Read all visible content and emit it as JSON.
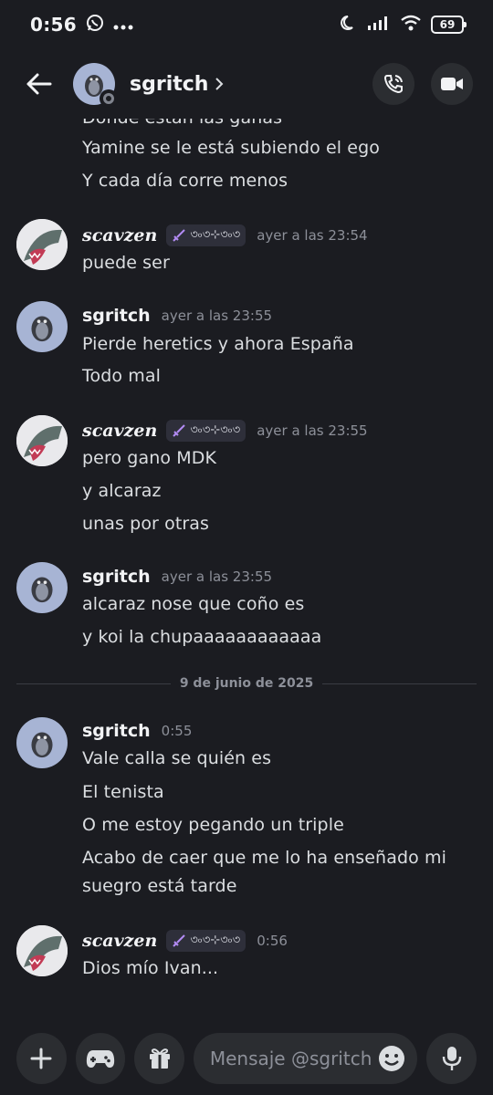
{
  "status_bar": {
    "time": "0:56",
    "battery": "69",
    "icons": [
      "whatsapp-icon",
      "more-icon",
      "moon-icon",
      "signal-icon",
      "wifi-icon",
      "battery-icon"
    ]
  },
  "header": {
    "name": "sgritch",
    "icons": [
      "back-arrow-icon",
      "chevron-right-icon",
      "voice-call-icon",
      "video-call-icon"
    ]
  },
  "chat": {
    "top_continuation": [
      "Donde están las ganas",
      "Yamine se le está subiendo el ego",
      "Y cada día corre menos"
    ],
    "messages": [
      {
        "author": "scavzen",
        "timestamp": "ayer a las 23:54",
        "lines": [
          "puede ser"
        ]
      },
      {
        "author": "sgritch",
        "timestamp": "ayer a las 23:55",
        "lines": [
          "Pierde heretics y ahora España",
          "Todo mal"
        ]
      },
      {
        "author": "scavzen",
        "timestamp": "ayer a las 23:55",
        "lines": [
          "pero gano MDK",
          "y alcaraz",
          "unas por otras"
        ]
      },
      {
        "author": "sgritch",
        "timestamp": "ayer a las 23:55",
        "lines": [
          "alcaraz nose que coño es",
          "y koi la chupaaaaaaaaaaaa"
        ]
      },
      {
        "author": "sgritch",
        "timestamp": "0:55",
        "lines": [
          "Vale calla se quién es",
          "El tenista",
          "O me estoy pegando un triple",
          "Acabo de caer que me lo ha enseñado mi",
          "suegro está tarde"
        ]
      },
      {
        "author": "scavzen",
        "timestamp": "0:56",
        "lines": [
          "Dios mío Ivan..."
        ]
      }
    ],
    "date_divider": "9 de junio de 2025",
    "tag_glyphs": "৩৹৩⊹৩৹৩"
  },
  "composer": {
    "placeholder": "Mensaje @sgritch",
    "icons": [
      "plus-icon",
      "gamepad-icon",
      "gift-icon",
      "emoji-icon",
      "microphone-icon"
    ]
  },
  "colors": {
    "background": "#1b1c21",
    "button_bg": "#2b2d31",
    "text": "#dbdee1",
    "muted": "#8d9099",
    "avatar_bg": "#a7b4d4"
  }
}
